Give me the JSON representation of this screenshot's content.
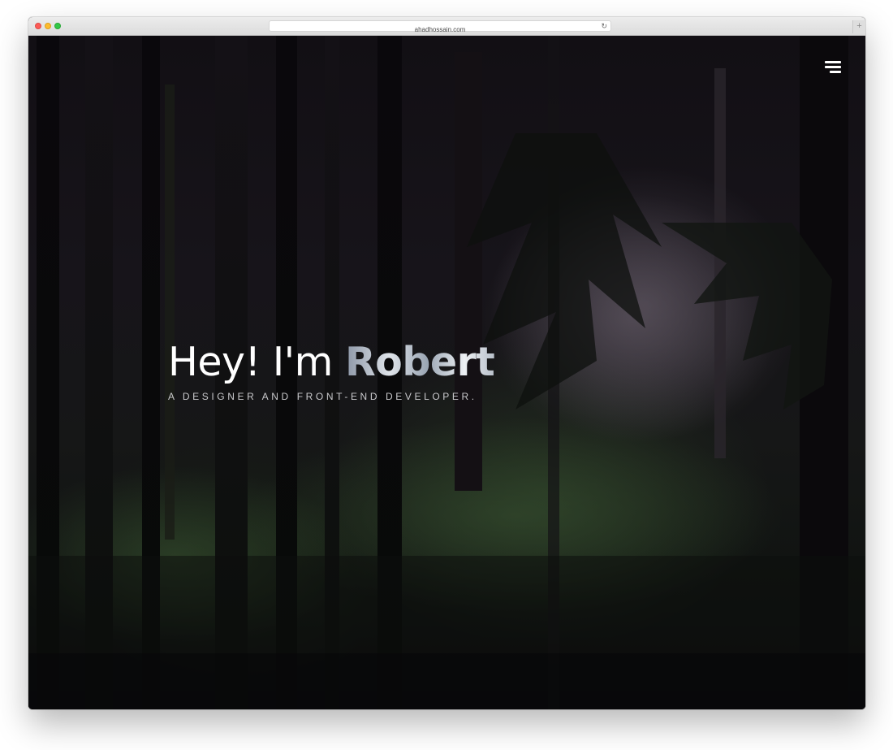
{
  "browser": {
    "url": "ahadhossain.com",
    "reload_icon": "reload-icon",
    "new_tab_icon": "plus-icon",
    "new_tab_glyph": "+"
  },
  "nav": {
    "menu_icon": "hamburger-menu-icon"
  },
  "hero": {
    "greeting": "Hey! I'm ",
    "name": "Robert",
    "subtitle": "A DESIGNER AND FRONT-END DEVELOPER."
  },
  "colors": {
    "background": "#0e0b10",
    "text": "#ffffff",
    "subtitle": "#c9c9cc",
    "close": "#fc5b57",
    "minimize": "#fdbc2e",
    "maximize": "#33c748"
  }
}
